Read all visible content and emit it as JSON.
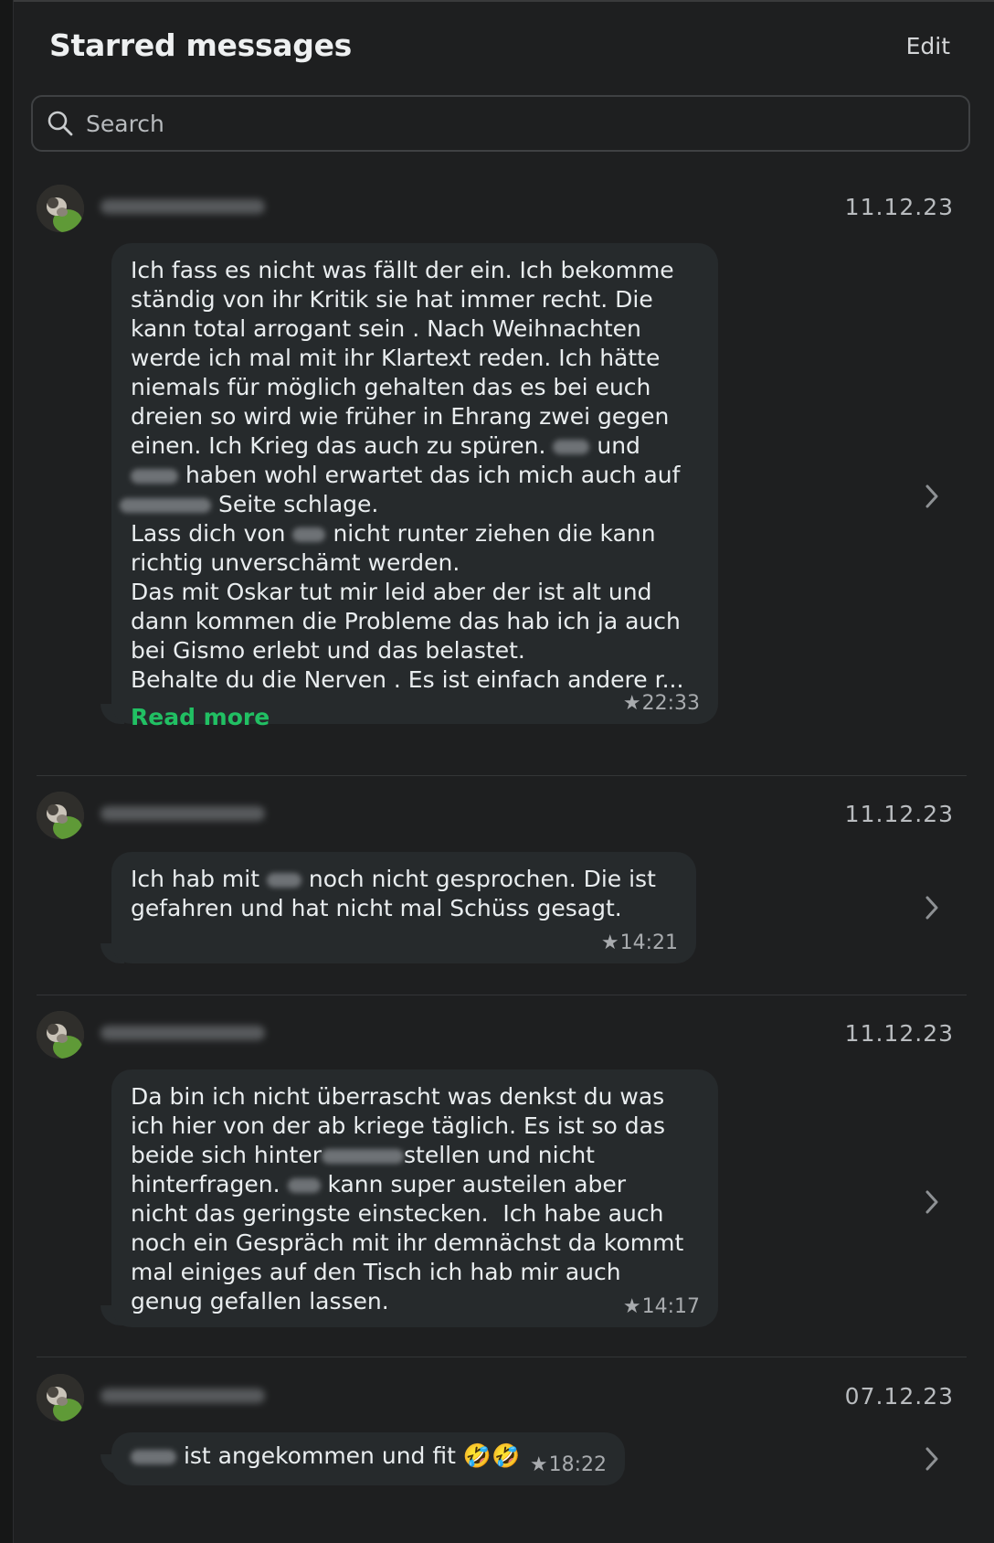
{
  "header": {
    "title": "Starred messages",
    "edit_label": "Edit"
  },
  "search": {
    "placeholder": "Search"
  },
  "messages": [
    {
      "date": "11.12.23",
      "lines": [
        "Ich fass es nicht was fällt der ein. Ich bekomme",
        "ständig von ihr Kritik sie hat immer recht. Die",
        "kann total arrogant sein . Nach Weihnachten",
        "werde ich mal mit ihr Klartext reden. Ich hätte",
        "niemals für möglich gehalten das es bei euch",
        "dreien so wird wie früher in Ehrang zwei gegen",
        "einen. Ich Krieg das auch zu spüren.",
        "und",
        "haben wohl erwartet das ich mich auch auf",
        "Seite schlage.",
        "Lass dich von",
        "nicht runter ziehen die kann",
        "richtig unverschämt werden.",
        "Das mit Oskar tut mir leid aber der ist alt und",
        "dann kommen die Probleme das hab ich ja auch",
        "bei Gismo erlebt und das belastet.",
        "Behalte du die Nerven . Es ist einfach andere r..."
      ],
      "read_more": "Read more",
      "time": "22:33"
    },
    {
      "date": "11.12.23",
      "lines": [
        "Ich hab mit",
        "noch nicht gesprochen. Die ist",
        "gefahren und hat nicht mal Schüss gesagt."
      ],
      "time": "14:21"
    },
    {
      "date": "11.12.23",
      "lines": [
        "Da bin ich nicht überrascht was denkst du was",
        "ich hier von der ab kriege täglich. Es ist so das",
        "beide sich hinter",
        "stellen und nicht",
        "hinterfragen.",
        "kann super austeilen aber",
        "nicht das geringste einstecken.  Ich habe auch",
        "noch ein Gespräch mit ihr demnächst da kommt",
        "mal einiges auf den Tisch ich hab mir auch",
        "genug gefallen lassen."
      ],
      "time": "14:17"
    },
    {
      "date": "07.12.23",
      "text": "ist angekommen und fit",
      "emoji": "🤣🤣",
      "time": "18:22"
    }
  ],
  "icons": {
    "search": "search-icon",
    "star": "star-icon",
    "chevron": "chevron-right-icon"
  },
  "colors": {
    "background": "#1e1f20",
    "bubble": "#262a2c",
    "read_more": "#21c063"
  }
}
